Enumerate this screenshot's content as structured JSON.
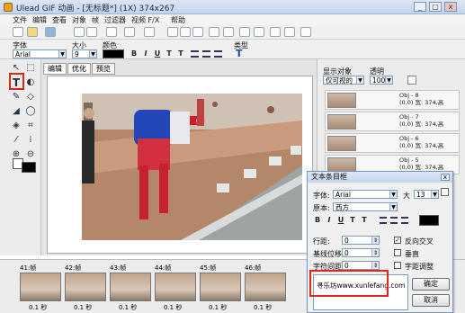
{
  "window": {
    "title": "Ulead GIF 动画 - [无标题*] (1X) 374x267",
    "controls": [
      "_",
      "□",
      "x"
    ]
  },
  "menu": [
    "文件",
    "编辑",
    "查看",
    "对象",
    "帧",
    "过滤器",
    "视频 F/X",
    "帮助"
  ],
  "format_bar": {
    "font_label": "字体",
    "font_value": "Arial",
    "size_label": "大小",
    "size_value": "9",
    "color_label": "颜色",
    "type_label": "类型",
    "style_buttons": [
      "B",
      "I",
      "U",
      "T",
      "T"
    ]
  },
  "tabs": [
    "编辑",
    "优化",
    "预览"
  ],
  "object_panel": {
    "display_label": "显示对象",
    "display_value": "仅可视的",
    "opacity_label": "透明",
    "opacity_value": "100",
    "objects": [
      {
        "name": "Obj - 8",
        "coords": "(0,0) 宽: 374,高"
      },
      {
        "name": "Obj - 7",
        "coords": "(0,0) 宽: 374,高"
      },
      {
        "name": "Obj - 6",
        "coords": "(0,0) 宽: 374,高"
      },
      {
        "name": "Obj - 5",
        "coords": "(0,0) 宽: 374,高"
      }
    ]
  },
  "frames": [
    {
      "label": "41:帧",
      "delay": "0.1 秒"
    },
    {
      "label": "42:帧",
      "delay": "0.1 秒"
    },
    {
      "label": "43:帧",
      "delay": "0.1 秒"
    },
    {
      "label": "44:帧",
      "delay": "0.1 秒"
    },
    {
      "label": "45:帧",
      "delay": "0.1 秒"
    },
    {
      "label": "46:帧",
      "delay": "0.1 秒"
    }
  ],
  "dialog": {
    "title": "文本条目框",
    "font_label": "字体:",
    "font_value": "Arial",
    "size_label": "大",
    "size_value": "13",
    "script_label": "原本:",
    "script_value": "西方",
    "spacing_label": "行距:",
    "spacing_value": "0",
    "baseline_label": "基线位移:",
    "baseline_value": "0",
    "char_label": "字符间距:",
    "char_value": "0",
    "antialias_label": "反向交叉",
    "vertical_label": "垂直",
    "kerning_label": "字距调整",
    "text": "寻乐坊www.xunlefang.com",
    "ok_label": "确定",
    "cancel_label": "取消"
  },
  "colors": {
    "highlight": "#e0261c",
    "accent": "#1d4f91"
  }
}
